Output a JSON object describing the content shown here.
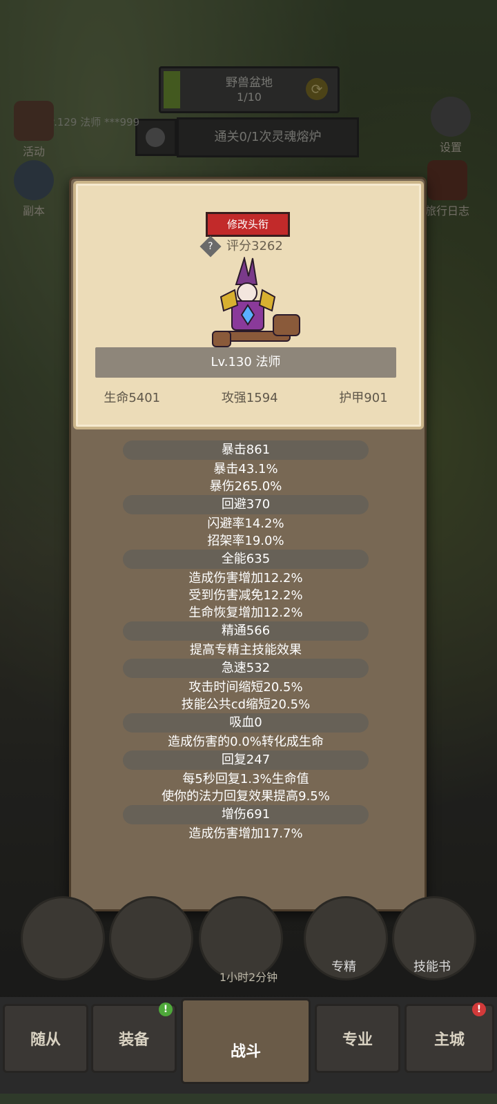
{
  "hud": {
    "zone_name": "野兽盆地",
    "zone_progress": "1/10",
    "quest_text": "通关0/1次灵魂熔炉",
    "player_info": "Lv.129 法师 ***999",
    "side_items": {
      "activity": "活动",
      "dungeon": "副本",
      "settings": "设置",
      "journal": "旅行日志"
    }
  },
  "profile": {
    "rename_label": "修改头衔",
    "score_label": "评分3262",
    "level_class": "Lv.130 法师",
    "hp": "生命5401",
    "attack": "攻强1594",
    "armor": "护甲901"
  },
  "stats": [
    {
      "head": "暴击861",
      "lines": [
        "暴击43.1%",
        "暴伤265.0%"
      ]
    },
    {
      "head": "回避370",
      "lines": [
        "闪避率14.2%",
        "招架率19.0%"
      ]
    },
    {
      "head": "全能635",
      "lines": [
        "造成伤害增加12.2%",
        "受到伤害减免12.2%",
        "生命恢复增加12.2%"
      ]
    },
    {
      "head": "精通566",
      "lines": [
        "提高专精主技能效果"
      ]
    },
    {
      "head": "急速532",
      "lines": [
        "攻击时间缩短20.5%",
        "技能公共cd缩短20.5%"
      ]
    },
    {
      "head": "吸血0",
      "lines": [
        "造成伤害的0.0%转化成生命"
      ]
    },
    {
      "head": "回复247",
      "lines": [
        "每5秒回复1.3%生命值",
        "使你的法力回复效果提高9.5%"
      ]
    },
    {
      "head": "增伤691",
      "lines": [
        "造成伤害增加17.7%"
      ]
    }
  ],
  "bottom": {
    "circles": [
      "专精",
      "技能书"
    ],
    "timer": "1小时2分钟"
  },
  "tabs": [
    "随从",
    "装备",
    "战斗",
    "专业",
    "主城"
  ],
  "colors": {
    "rename_button": "#c22a2a",
    "parchment": "#ecdcb8",
    "panel": "#786854",
    "badge_green": "#4ea83a",
    "badge_red": "#d23a3a"
  }
}
